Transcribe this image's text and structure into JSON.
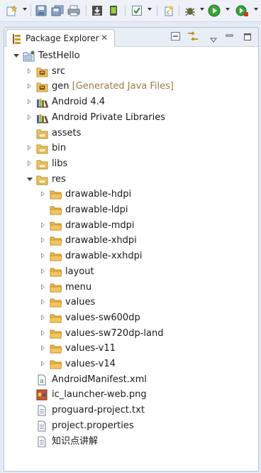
{
  "toolbar": {
    "buttons": [
      "new-wizard",
      "save",
      "save-all",
      "print",
      "download-sdk",
      "avd-manager",
      "check-tasks",
      "new-android-class",
      "debug",
      "run",
      "external-tool"
    ]
  },
  "view": {
    "tab_label": "Package Explorer",
    "close_glyph": "✕"
  },
  "tree": [
    {
      "label": "TestHello",
      "depth": 0,
      "twisty": "open",
      "icon": "project-icon"
    },
    {
      "label": "src",
      "depth": 1,
      "twisty": "closed",
      "icon": "source-folder-icon"
    },
    {
      "label": "gen",
      "decoration": "[Generated Java Files]",
      "depth": 1,
      "twisty": "closed",
      "icon": "gen-folder-icon"
    },
    {
      "label": "Android 4.4",
      "depth": 1,
      "twisty": "closed",
      "icon": "library-icon"
    },
    {
      "label": "Android Private Libraries",
      "depth": 1,
      "twisty": "closed",
      "icon": "library-icon"
    },
    {
      "label": "assets",
      "depth": 1,
      "twisty": "none",
      "icon": "package-folder-icon"
    },
    {
      "label": "bin",
      "depth": 1,
      "twisty": "closed",
      "icon": "package-folder-icon"
    },
    {
      "label": "libs",
      "depth": 1,
      "twisty": "closed",
      "icon": "package-folder-icon"
    },
    {
      "label": "res",
      "depth": 1,
      "twisty": "open",
      "icon": "package-folder-icon"
    },
    {
      "label": "drawable-hdpi",
      "depth": 2,
      "twisty": "closed",
      "icon": "folder-icon"
    },
    {
      "label": "drawable-ldpi",
      "depth": 2,
      "twisty": "none",
      "icon": "folder-icon"
    },
    {
      "label": "drawable-mdpi",
      "depth": 2,
      "twisty": "closed",
      "icon": "folder-icon"
    },
    {
      "label": "drawable-xhdpi",
      "depth": 2,
      "twisty": "closed",
      "icon": "folder-icon"
    },
    {
      "label": "drawable-xxhdpi",
      "depth": 2,
      "twisty": "closed",
      "icon": "folder-icon"
    },
    {
      "label": "layout",
      "depth": 2,
      "twisty": "closed",
      "icon": "folder-icon"
    },
    {
      "label": "menu",
      "depth": 2,
      "twisty": "closed",
      "icon": "folder-icon"
    },
    {
      "label": "values",
      "depth": 2,
      "twisty": "closed",
      "icon": "folder-icon"
    },
    {
      "label": "values-sw600dp",
      "depth": 2,
      "twisty": "closed",
      "icon": "folder-icon"
    },
    {
      "label": "values-sw720dp-land",
      "depth": 2,
      "twisty": "closed",
      "icon": "folder-icon"
    },
    {
      "label": "values-v11",
      "depth": 2,
      "twisty": "closed",
      "icon": "folder-icon"
    },
    {
      "label": "values-v14",
      "depth": 2,
      "twisty": "closed",
      "icon": "folder-icon"
    },
    {
      "label": "AndroidManifest.xml",
      "depth": 1,
      "twisty": "none",
      "icon": "xml-file-icon"
    },
    {
      "label": "ic_launcher-web.png",
      "depth": 1,
      "twisty": "none",
      "icon": "image-file-icon"
    },
    {
      "label": "proguard-project.txt",
      "depth": 1,
      "twisty": "none",
      "icon": "text-file-icon"
    },
    {
      "label": "project.properties",
      "depth": 1,
      "twisty": "none",
      "icon": "text-file-icon"
    },
    {
      "label": "知识点讲解",
      "depth": 1,
      "twisty": "none",
      "icon": "text-file-icon"
    }
  ],
  "colors": {
    "folder": "#f2c562",
    "folder_edge": "#c08a1e",
    "decoration": "#9a7a46",
    "selection": "#cfe0f5"
  }
}
